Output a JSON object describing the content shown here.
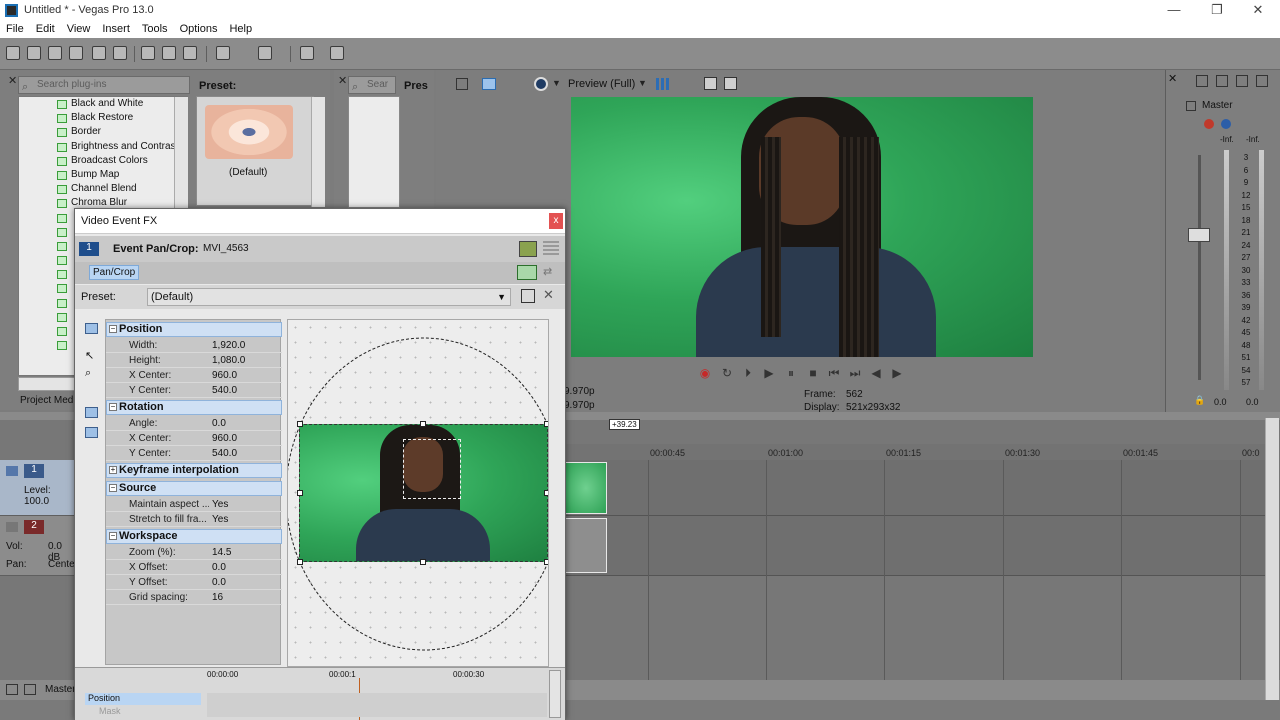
{
  "window": {
    "title": "Untitled * - Vegas Pro 13.0"
  },
  "menu": [
    "File",
    "Edit",
    "View",
    "Insert",
    "Tools",
    "Options",
    "Help"
  ],
  "left_panel": {
    "search_placeholder": "Search plug-ins",
    "preset_label": "Preset:",
    "preset_default": "(Default)",
    "plugins": [
      "Black and White",
      "Black Restore",
      "Border",
      "Brightness and Contrast",
      "Broadcast Colors",
      "Bump Map",
      "Channel Blend",
      "Chroma Blur"
    ],
    "bottom_tab": "Project Medi"
  },
  "mid_panel": {
    "search_placeholder": "Sear",
    "preset_label": "Pres"
  },
  "preview": {
    "mode": "Preview (Full)",
    "time1": "9.970p",
    "time2": "9.970p",
    "frame_label": "Frame:",
    "frame_value": "562",
    "display_label": "Display:",
    "display_value": "521x293x32"
  },
  "mixer": {
    "title": "Master",
    "inf_left": "-Inf.",
    "inf_right": "-Inf.",
    "scale": [
      "3",
      "6",
      "9",
      "12",
      "15",
      "18",
      "21",
      "24",
      "27",
      "30",
      "33",
      "36",
      "39",
      "42",
      "45",
      "48",
      "51",
      "54",
      "57"
    ],
    "value_left": "0.0",
    "value_right": "0.0"
  },
  "timeline": {
    "marker": "+39.23",
    "ruler": [
      "00:00:45",
      "00:01:00",
      "00:01:15",
      "00:01:30",
      "00:01:45",
      "00:0"
    ],
    "track1": {
      "num": "1",
      "level": "Level: 100.0"
    },
    "track2": {
      "num": "2",
      "vol": "Vol:",
      "vol_value": "0.0 dB",
      "pan": "Pan:",
      "pan_value": "Cente"
    },
    "master_label": "Master"
  },
  "fx_window": {
    "title": "Video Event FX",
    "close": "x",
    "event_label": "Event Pan/Crop:",
    "event_name": "MVI_4563",
    "chain_num": "1",
    "chain_item": "Pan/Crop",
    "preset_label": "Preset:",
    "preset_value": "(Default)",
    "sections": {
      "position": {
        "title": "Position",
        "rows": [
          [
            "Width:",
            "1,920.0"
          ],
          [
            "Height:",
            "1,080.0"
          ],
          [
            "X Center:",
            "960.0"
          ],
          [
            "Y Center:",
            "540.0"
          ]
        ]
      },
      "rotation": {
        "title": "Rotation",
        "rows": [
          [
            "Angle:",
            "0.0"
          ],
          [
            "X Center:",
            "960.0"
          ],
          [
            "Y Center:",
            "540.0"
          ]
        ]
      },
      "keyframe": {
        "title": "Keyframe interpolation"
      },
      "source": {
        "title": "Source",
        "rows": [
          [
            "Maintain aspect ...",
            "Yes"
          ],
          [
            "Stretch to fill fra...",
            "Yes"
          ]
        ]
      },
      "workspace": {
        "title": "Workspace",
        "rows": [
          [
            "Zoom (%):",
            "14.5"
          ],
          [
            "X Offset:",
            "0.0"
          ],
          [
            "Y Offset:",
            "0.0"
          ],
          [
            "Grid spacing:",
            "16"
          ]
        ]
      }
    },
    "keyframe_track": {
      "position": "Position",
      "mask": "Mask",
      "t0": "00:00:00",
      "t1": "00:00:1",
      "t2": "00:00:30"
    }
  }
}
